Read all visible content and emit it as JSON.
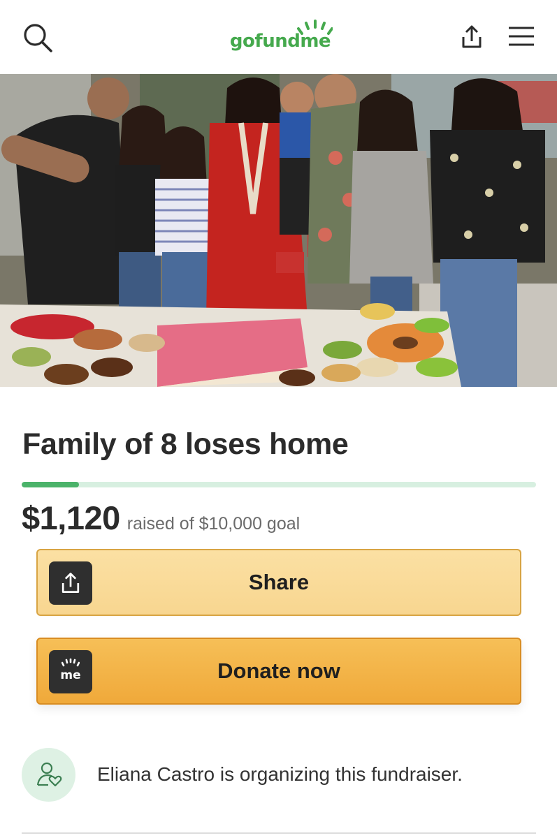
{
  "header": {
    "logo_text": "gofundme",
    "search_icon": "search-icon",
    "share_icon": "share-upload-icon",
    "menu_icon": "hamburger-menu-icon",
    "brand_color": "#45a94d"
  },
  "hero": {
    "alt": "Family photo at graduation party with cake and food on table"
  },
  "campaign": {
    "title": "Family of 8 loses home",
    "raised": "$1,120",
    "goal_text": "raised of $10,000 goal",
    "progress_fraction": 0.112
  },
  "actions": {
    "share_label": "Share",
    "donate_label": "Donate now",
    "donate_icon_text": "me"
  },
  "organizer": {
    "text": "Eliana Castro is organizing this fundraiser.",
    "icon": "person-heart-icon"
  },
  "colors": {
    "progress_fill": "#4bb36a",
    "progress_track": "#d7efe0",
    "share_button": "#f8d690",
    "donate_button": "#f0a93a"
  }
}
